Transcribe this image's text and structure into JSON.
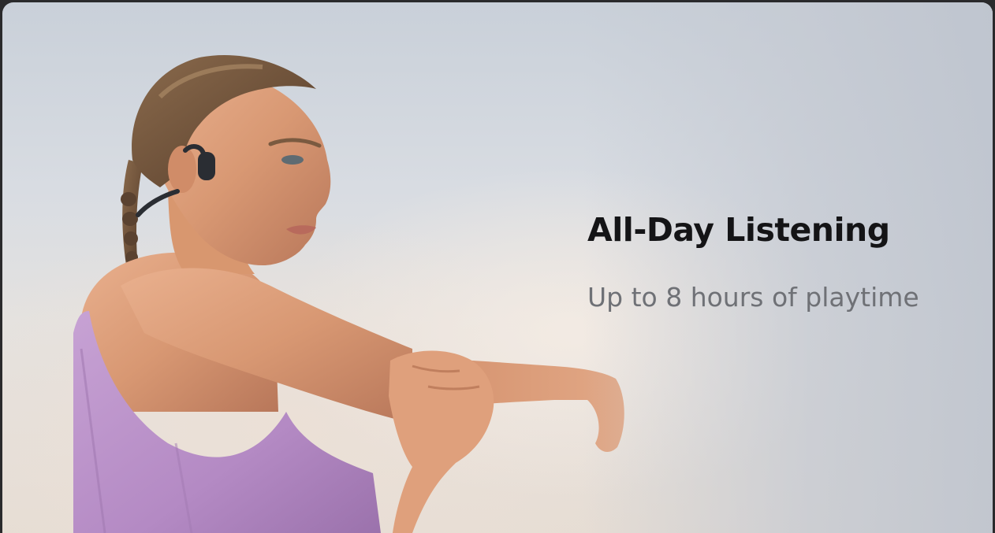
{
  "feature": {
    "headline": "All-Day Listening",
    "subhead": "Up to 8 hours of playtime"
  },
  "colors": {
    "headline": "#141416",
    "subhead": "#6f7176",
    "shirt": "#b48ac4",
    "headphones": "#2a2d33"
  },
  "icons": {
    "headphones": "bone-conduction-headphones"
  }
}
